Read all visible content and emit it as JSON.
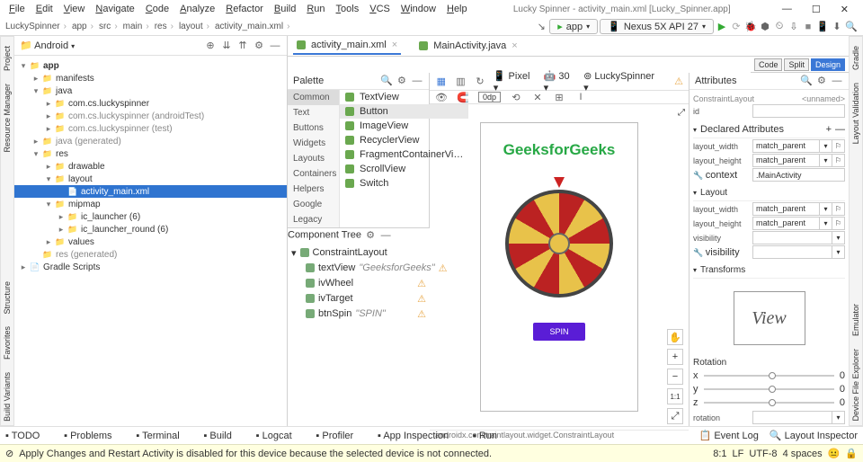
{
  "window": {
    "title": "Lucky Spinner - activity_main.xml [Lucky_Spinner.app]",
    "menus": [
      "File",
      "Edit",
      "View",
      "Navigate",
      "Code",
      "Analyze",
      "Refactor",
      "Build",
      "Run",
      "Tools",
      "VCS",
      "Window",
      "Help"
    ]
  },
  "breadcrumbs": [
    "LuckySpinner",
    "app",
    "src",
    "main",
    "res",
    "layout",
    "activity_main.xml"
  ],
  "run": {
    "config": "app",
    "device": "Nexus 5X API 27"
  },
  "projectPanel": {
    "dropdown": "Android"
  },
  "tree": [
    {
      "depth": 0,
      "chev": "▾",
      "icon": "folder",
      "label": "app",
      "bold": true
    },
    {
      "depth": 1,
      "chev": "▸",
      "icon": "folder",
      "label": "manifests"
    },
    {
      "depth": 1,
      "chev": "▾",
      "icon": "folder",
      "label": "java"
    },
    {
      "depth": 2,
      "chev": "▸",
      "icon": "folder",
      "label": "com.cs.luckyspinner"
    },
    {
      "depth": 2,
      "chev": "▸",
      "icon": "folder",
      "label": "com.cs.luckyspinner (androidTest)",
      "dim": true
    },
    {
      "depth": 2,
      "chev": "▸",
      "icon": "folder",
      "label": "com.cs.luckyspinner (test)",
      "dim": true
    },
    {
      "depth": 1,
      "chev": "▸",
      "icon": "folder",
      "label": "java (generated)",
      "dim": true
    },
    {
      "depth": 1,
      "chev": "▾",
      "icon": "folder",
      "label": "res"
    },
    {
      "depth": 2,
      "chev": "▸",
      "icon": "folder",
      "label": "drawable"
    },
    {
      "depth": 2,
      "chev": "▾",
      "icon": "folder",
      "label": "layout"
    },
    {
      "depth": 3,
      "chev": "",
      "icon": "file",
      "label": "activity_main.xml",
      "sel": true
    },
    {
      "depth": 2,
      "chev": "▾",
      "icon": "folder",
      "label": "mipmap"
    },
    {
      "depth": 3,
      "chev": "▸",
      "icon": "folder",
      "label": "ic_launcher (6)"
    },
    {
      "depth": 3,
      "chev": "▸",
      "icon": "folder",
      "label": "ic_launcher_round (6)"
    },
    {
      "depth": 2,
      "chev": "▸",
      "icon": "folder",
      "label": "values"
    },
    {
      "depth": 1,
      "chev": "",
      "icon": "folder",
      "label": "res (generated)",
      "dim": true
    },
    {
      "depth": 0,
      "chev": "▸",
      "icon": "file",
      "label": "Gradle Scripts"
    }
  ],
  "tabs": [
    {
      "label": "activity_main.xml",
      "active": true
    },
    {
      "label": "MainActivity.java",
      "active": false
    }
  ],
  "palette": {
    "title": "Palette",
    "categories": [
      "Common",
      "Text",
      "Buttons",
      "Widgets",
      "Layouts",
      "Containers",
      "Helpers",
      "Google",
      "Legacy"
    ],
    "activeCategory": "Common",
    "items": [
      "TextView",
      "Button",
      "ImageView",
      "RecyclerView",
      "FragmentContainerVi…",
      "ScrollView",
      "Switch"
    ],
    "selectedItem": "Button"
  },
  "componentTree": {
    "title": "Component Tree",
    "root": "ConstraintLayout",
    "rows": [
      {
        "name": "textView",
        "val": "\"GeeksforGeeks\"",
        "warn": true
      },
      {
        "name": "ivWheel",
        "val": "",
        "warn": true
      },
      {
        "name": "ivTarget",
        "val": "",
        "warn": true
      },
      {
        "name": "btnSpin",
        "val": "\"SPIN\"",
        "warn": true
      }
    ]
  },
  "previewToolbar": {
    "device": "Pixel",
    "api": "30",
    "theme": "LuckySpinner",
    "default": "0dp"
  },
  "preview": {
    "title": "GeeksforGeeks",
    "button": "SPIN"
  },
  "viewModes": [
    "Code",
    "Split",
    "Design"
  ],
  "attributes": {
    "title": "Attributes",
    "type": "ConstraintLayout",
    "typeVal": "<unnamed>",
    "id_label": "id",
    "declared_title": "Declared Attributes",
    "layout_title": "Layout",
    "transforms_title": "Transforms",
    "rows": {
      "layout_width_label": "layout_width",
      "layout_width": "match_parent",
      "layout_height_label": "layout_height",
      "layout_height": "match_parent",
      "context_label": "context",
      "context": ".MainActivity",
      "visibility_label": "visibility",
      "cvisibility_label": "visibility"
    },
    "view_label": "View",
    "rotation_title": "Rotation",
    "sliders": [
      {
        "axis": "x",
        "val": "0"
      },
      {
        "axis": "y",
        "val": "0"
      },
      {
        "axis": "z",
        "val": "0"
      }
    ],
    "rotation_label": "rotation"
  },
  "pathBar": "androidx.constraintlayout.widget.ConstraintLayout",
  "footer": {
    "items": [
      "TODO",
      "Problems",
      "Terminal",
      "Build",
      "Logcat",
      "Profiler",
      "App Inspection",
      "Run"
    ],
    "right": [
      "Event Log",
      "Layout Inspector"
    ]
  },
  "statusRight": {
    "pos": "8:1",
    "le": "LF",
    "enc": "UTF-8",
    "spaces": "4 spaces"
  },
  "warning": "Apply Changes and Restart Activity is disabled for this device because the selected device is not connected."
}
